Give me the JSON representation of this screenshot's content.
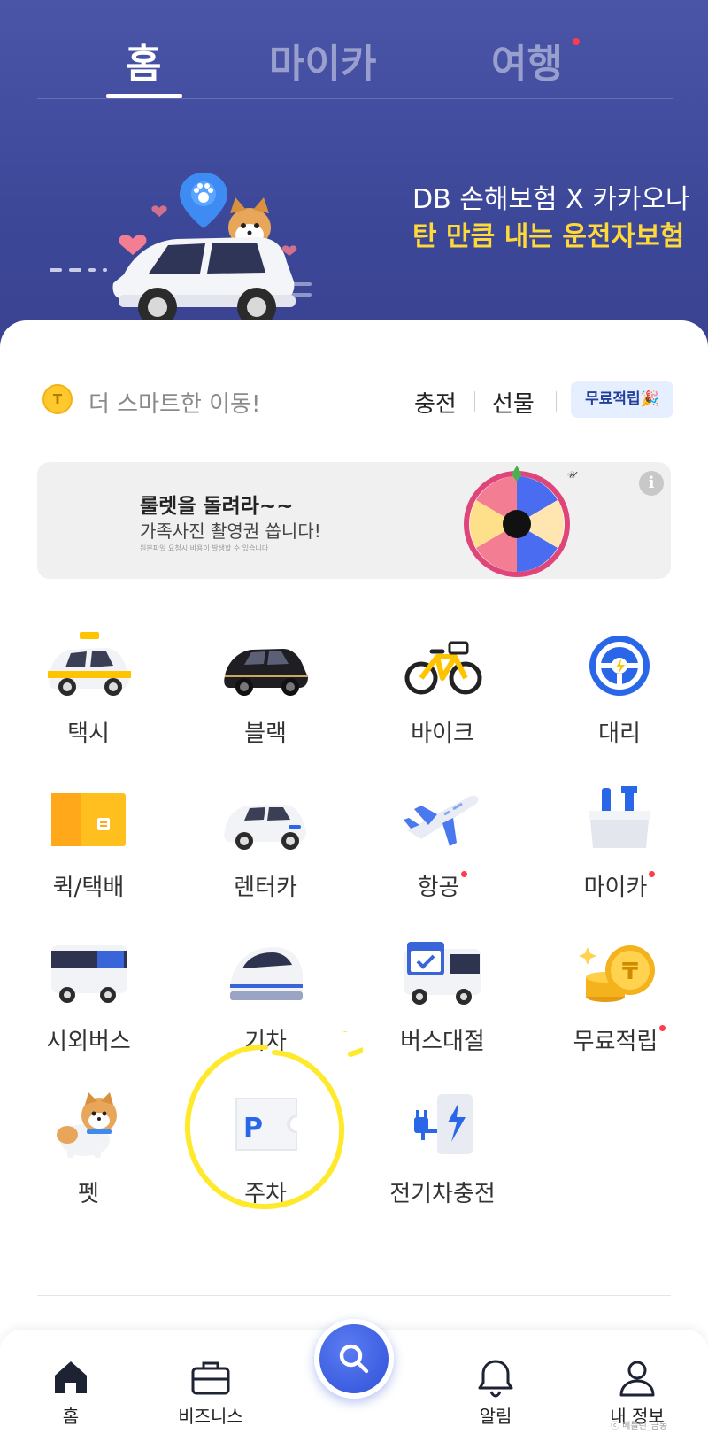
{
  "tabs": {
    "home": "홈",
    "mycar": "마이카",
    "travel": "여행"
  },
  "promo": {
    "line1": "DB 손해보험 X 카카오나",
    "line2": "탄 만큼 내는 운전자보험"
  },
  "points": {
    "coin": "T",
    "text": "더 스마트한 이동!",
    "charge": "충전",
    "gift": "선물",
    "free": "무료적립🎉"
  },
  "banner": {
    "title": "룰렛을 돌려라~~",
    "subtitle": "가족사진 촬영권 쏩니다!",
    "fine": "원본파일 요청시 비용이 발생할 수 있습니다",
    "info": "i"
  },
  "services": [
    {
      "label": "택시",
      "icon": "taxi-icon",
      "dot": false
    },
    {
      "label": "블랙",
      "icon": "black-car-icon",
      "dot": false
    },
    {
      "label": "바이크",
      "icon": "bike-icon",
      "dot": false
    },
    {
      "label": "대리",
      "icon": "steering-wheel-icon",
      "dot": false
    },
    {
      "label": "퀵/택배",
      "icon": "box-icon",
      "dot": false
    },
    {
      "label": "렌터카",
      "icon": "rental-car-icon",
      "dot": false
    },
    {
      "label": "항공",
      "icon": "airplane-icon",
      "dot": true
    },
    {
      "label": "마이카",
      "icon": "toolbox-icon",
      "dot": true
    },
    {
      "label": "시외버스",
      "icon": "bus-icon",
      "dot": false
    },
    {
      "label": "기차",
      "icon": "train-icon",
      "dot": false
    },
    {
      "label": "버스대절",
      "icon": "charter-bus-icon",
      "dot": false
    },
    {
      "label": "무료적립",
      "icon": "coin-stack-icon",
      "dot": true
    },
    {
      "label": "펫",
      "icon": "pet-dog-icon",
      "dot": false
    },
    {
      "label": "주차",
      "icon": "parking-icon",
      "dot": false
    },
    {
      "label": "전기차충전",
      "icon": "ev-charger-icon",
      "dot": false
    }
  ],
  "nav": {
    "home": "홈",
    "business": "비즈니스",
    "alarm": "알림",
    "profile": "내 정보"
  },
  "watermark": "ⓒ 메를린_금동",
  "colors": {
    "hero_bg": "#3f4a9c",
    "accent_yellow": "#ffd93a",
    "brand_blue": "#2f51d8",
    "red_dot": "#ff3b4b"
  }
}
